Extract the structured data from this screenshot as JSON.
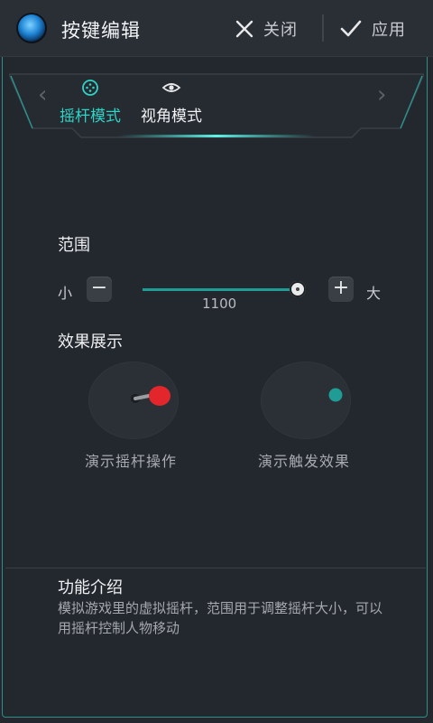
{
  "header": {
    "title": "按键编辑",
    "close_label": "关闭",
    "apply_label": "应用"
  },
  "tabs": [
    {
      "label": "摇杆模式",
      "icon": "joystick-icon",
      "active": true
    },
    {
      "label": "视角模式",
      "icon": "eye-icon",
      "active": false
    }
  ],
  "range": {
    "title": "范围",
    "min_label": "小",
    "max_label": "大",
    "value": "1100",
    "level": 0.95
  },
  "demo": {
    "title": "效果展示",
    "joystick_caption": "演示摇杆操作",
    "trigger_caption": "演示触发效果"
  },
  "intro": {
    "title": "功能介绍",
    "text": "模拟游戏里的虚拟摇杆，范围用于调整摇杆大小，可以用摇杆控制人物移动"
  },
  "colors": {
    "accent": "#2fd4c6",
    "background": "#23272e",
    "joystick_knob": "#e3262b"
  }
}
